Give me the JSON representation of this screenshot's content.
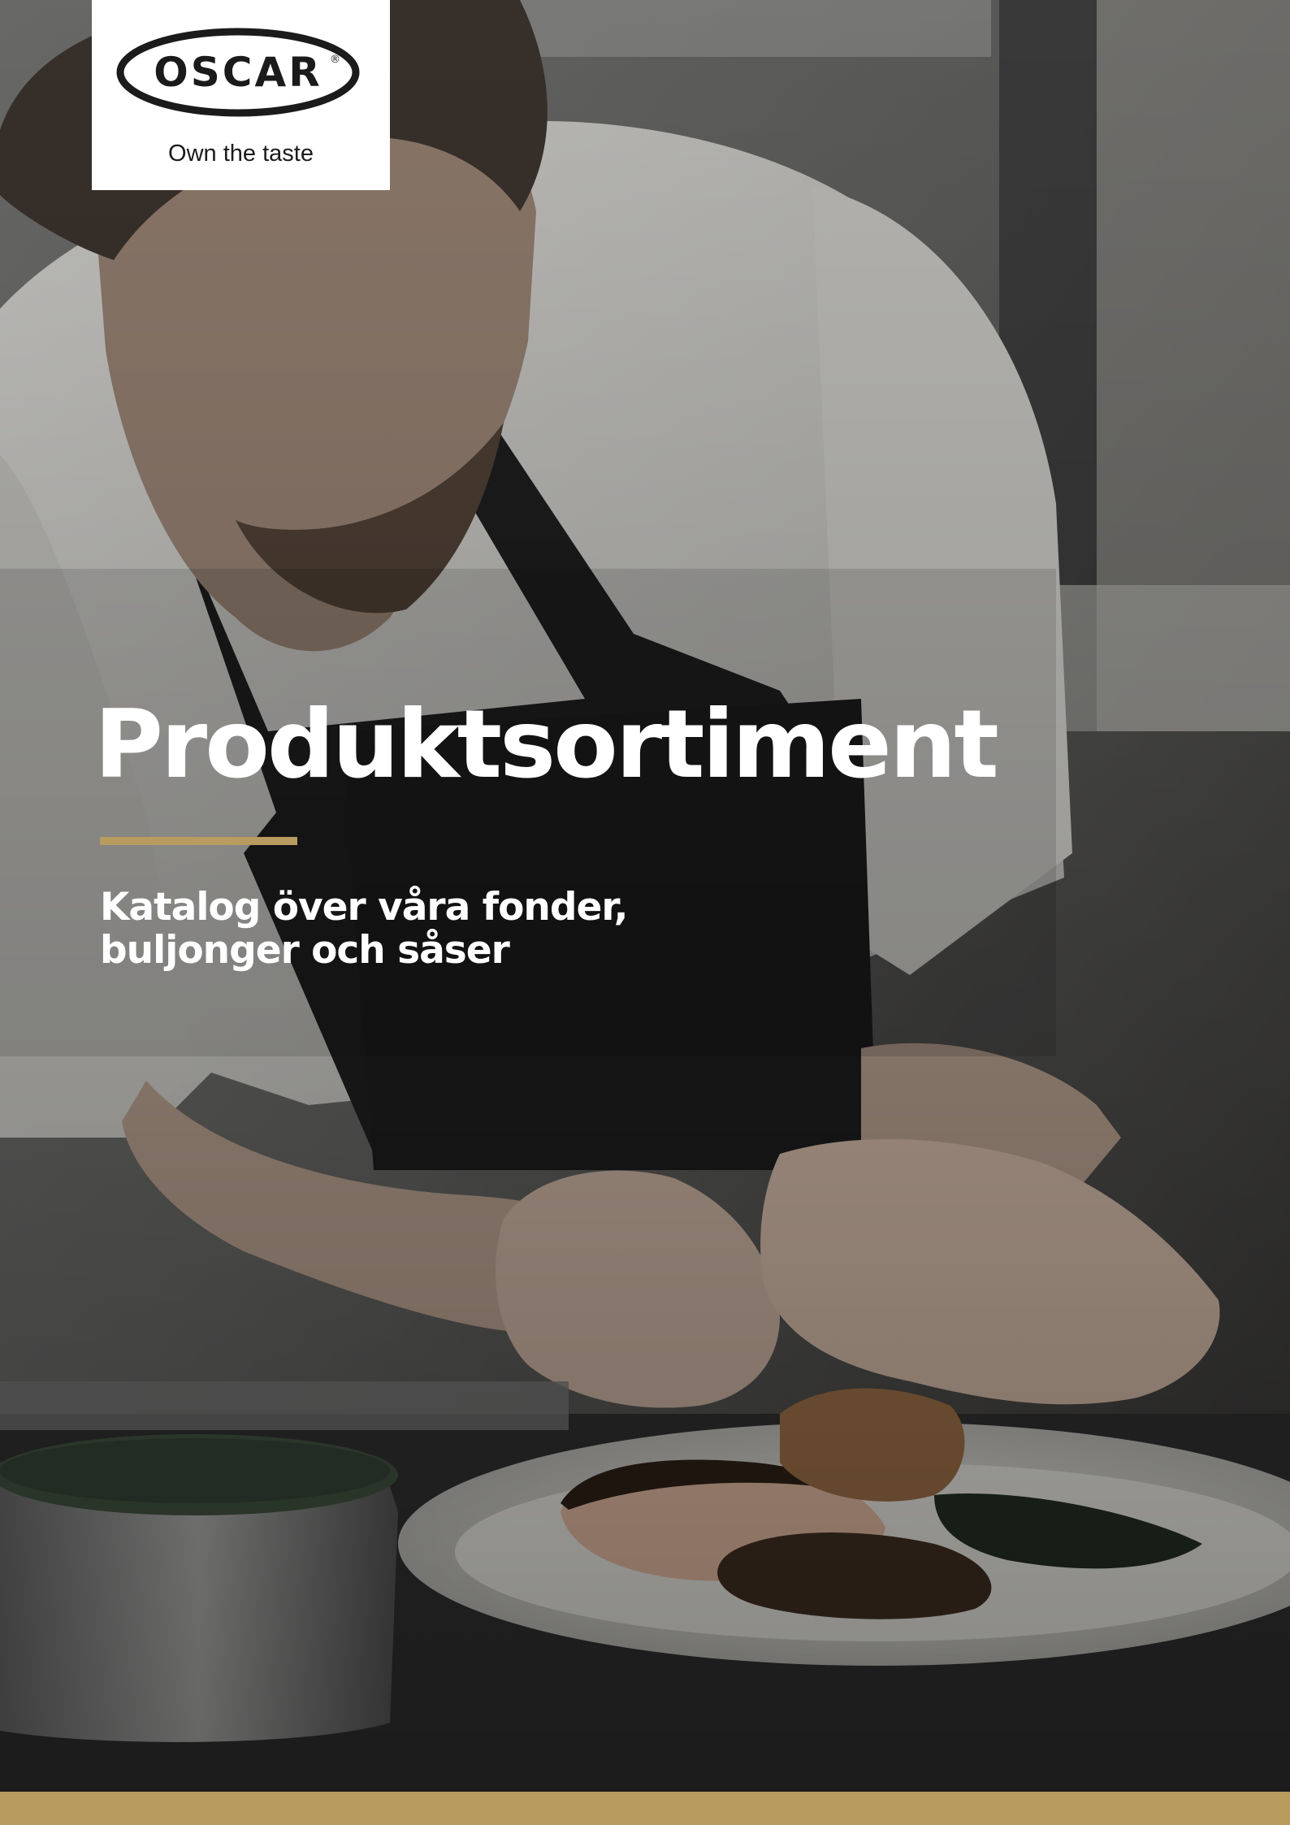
{
  "brand": {
    "wordmark": "OSCAR",
    "registered": "®",
    "tagline": "Own the taste"
  },
  "cover": {
    "title": "Produktsortiment",
    "subtitle_lines": [
      "Katalog över våra fonder,",
      "buljonger och såser"
    ]
  },
  "colors": {
    "accent_gold": "#b89b5e",
    "title_text": "#ffffff",
    "logo_background": "#ffffff"
  },
  "photo": {
    "icon": "chef-plating-dish-photo"
  }
}
